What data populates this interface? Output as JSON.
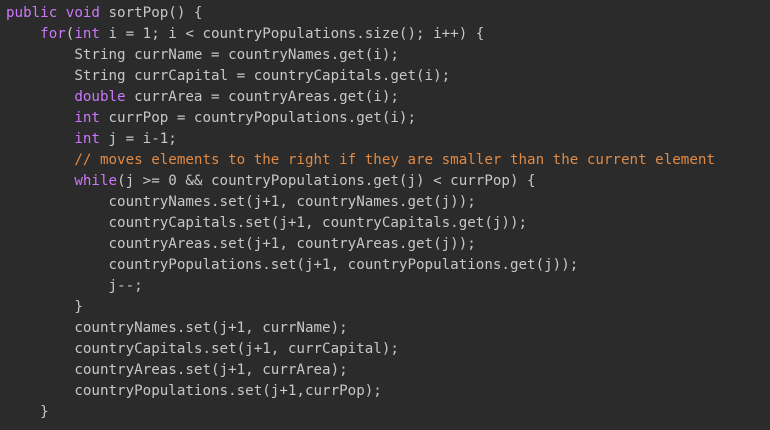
{
  "editor": {
    "colors": {
      "background": "#2b2b2b",
      "default_text": "#c7c7c7",
      "keyword": "#cc78fa",
      "comment": "#e08a46"
    },
    "lines": [
      {
        "indent": 0,
        "tokens": [
          {
            "t": "public",
            "c": "keyword"
          },
          {
            "t": " ",
            "c": "plain"
          },
          {
            "t": "void",
            "c": "keyword"
          },
          {
            "t": " sortPop() {",
            "c": "plain"
          }
        ]
      },
      {
        "indent": 4,
        "tokens": [
          {
            "t": "for",
            "c": "keyword"
          },
          {
            "t": "(",
            "c": "plain"
          },
          {
            "t": "int",
            "c": "keyword"
          },
          {
            "t": " i = 1; i < countryPopulations.size(); i++) {",
            "c": "plain"
          }
        ]
      },
      {
        "indent": 8,
        "tokens": [
          {
            "t": "String currName = countryNames.get(i);",
            "c": "plain"
          }
        ]
      },
      {
        "indent": 8,
        "tokens": [
          {
            "t": "String currCapital = countryCapitals.get(i);",
            "c": "plain"
          }
        ]
      },
      {
        "indent": 8,
        "tokens": [
          {
            "t": "double",
            "c": "type"
          },
          {
            "t": " currArea = countryAreas.get(i);",
            "c": "plain"
          }
        ]
      },
      {
        "indent": 8,
        "tokens": [
          {
            "t": "int",
            "c": "type"
          },
          {
            "t": " currPop = countryPopulations.get(i);",
            "c": "plain"
          }
        ]
      },
      {
        "indent": 8,
        "tokens": [
          {
            "t": "int",
            "c": "type"
          },
          {
            "t": " j = i-1;",
            "c": "plain"
          }
        ]
      },
      {
        "indent": 8,
        "tokens": [
          {
            "t": "// moves elements to the right if they are smaller than the current element",
            "c": "comment"
          }
        ]
      },
      {
        "indent": 8,
        "tokens": [
          {
            "t": "while",
            "c": "keyword"
          },
          {
            "t": "(j >= 0 && countryPopulations.get(j) < currPop) {",
            "c": "plain"
          }
        ]
      },
      {
        "indent": 12,
        "tokens": [
          {
            "t": "countryNames.set(j+1, countryNames.get(j));",
            "c": "plain"
          }
        ]
      },
      {
        "indent": 12,
        "tokens": [
          {
            "t": "countryCapitals.set(j+1, countryCapitals.get(j));",
            "c": "plain"
          }
        ]
      },
      {
        "indent": 12,
        "tokens": [
          {
            "t": "countryAreas.set(j+1, countryAreas.get(j));",
            "c": "plain"
          }
        ]
      },
      {
        "indent": 12,
        "tokens": [
          {
            "t": "countryPopulations.set(j+1, countryPopulations.get(j));",
            "c": "plain"
          }
        ]
      },
      {
        "indent": 12,
        "tokens": [
          {
            "t": "j--;",
            "c": "plain"
          }
        ]
      },
      {
        "indent": 8,
        "tokens": [
          {
            "t": "}",
            "c": "plain"
          }
        ]
      },
      {
        "indent": 8,
        "tokens": [
          {
            "t": "countryNames.set(j+1, currName);",
            "c": "plain"
          }
        ]
      },
      {
        "indent": 8,
        "tokens": [
          {
            "t": "countryCapitals.set(j+1, currCapital);",
            "c": "plain"
          }
        ]
      },
      {
        "indent": 8,
        "tokens": [
          {
            "t": "countryAreas.set(j+1, currArea);",
            "c": "plain"
          }
        ]
      },
      {
        "indent": 8,
        "tokens": [
          {
            "t": "countryPopulations.set(j+1,currPop);",
            "c": "plain"
          }
        ]
      },
      {
        "indent": 4,
        "tokens": [
          {
            "t": "}",
            "c": "plain"
          }
        ]
      },
      {
        "indent": 4,
        "tokens": [
          {
            "t": "}",
            "c": "cutoff"
          }
        ]
      }
    ]
  }
}
